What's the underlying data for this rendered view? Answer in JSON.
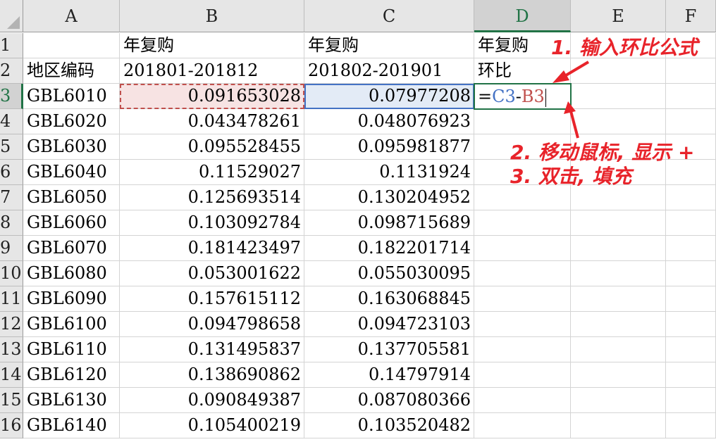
{
  "columns": [
    "A",
    "B",
    "C",
    "D",
    "E",
    "F"
  ],
  "active_cell": "D3",
  "rows": [
    {
      "num": "1",
      "a": "",
      "b": "年复购",
      "c": "年复购",
      "d": "年复购"
    },
    {
      "num": "2",
      "a": "地区编码",
      "b": "201801-201812",
      "c": "201802-201901",
      "d": "环比"
    },
    {
      "num": "3",
      "a": "GBL6010",
      "b": "0.091653028",
      "c": "0.07977208",
      "d": ""
    },
    {
      "num": "4",
      "a": "GBL6020",
      "b": "0.043478261",
      "c": "0.048076923",
      "d": ""
    },
    {
      "num": "5",
      "a": "GBL6030",
      "b": "0.095528455",
      "c": "0.095981877",
      "d": ""
    },
    {
      "num": "6",
      "a": "GBL6040",
      "b": "0.11529027",
      "c": "0.1131924",
      "d": ""
    },
    {
      "num": "7",
      "a": "GBL6050",
      "b": "0.125693514",
      "c": "0.130204952",
      "d": ""
    },
    {
      "num": "8",
      "a": "GBL6060",
      "b": "0.103092784",
      "c": "0.098715689",
      "d": ""
    },
    {
      "num": "9",
      "a": "GBL6070",
      "b": "0.181423497",
      "c": "0.182201714",
      "d": ""
    },
    {
      "num": "10",
      "a": "GBL6080",
      "b": "0.053001622",
      "c": "0.055030095",
      "d": ""
    },
    {
      "num": "11",
      "a": "GBL6090",
      "b": "0.157615112",
      "c": "0.163068845",
      "d": ""
    },
    {
      "num": "12",
      "a": "GBL6100",
      "b": "0.094798658",
      "c": "0.094723103",
      "d": ""
    },
    {
      "num": "13",
      "a": "GBL6110",
      "b": "0.131495837",
      "c": "0.137705581",
      "d": ""
    },
    {
      "num": "14",
      "a": "GBL6120",
      "b": "0.138690862",
      "c": "0.14797914",
      "d": ""
    },
    {
      "num": "15",
      "a": "GBL6130",
      "b": "0.090849387",
      "c": "0.087080366",
      "d": ""
    },
    {
      "num": "16",
      "a": "GBL6140",
      "b": "0.105400219",
      "c": "0.103520482",
      "d": ""
    }
  ],
  "formula": {
    "eq": "=",
    "ref1": "C3",
    "op": "-",
    "ref2": "B3"
  },
  "annotations": {
    "step1": "1. 输入环比公式",
    "step2": "2. 移动鼠标, 显示 +",
    "step3": "3. 双击, 填充"
  },
  "colors": {
    "annotation": "#e8232a",
    "selection": "#217346",
    "ref1": "#4472c4",
    "ref2": "#c0504d"
  }
}
